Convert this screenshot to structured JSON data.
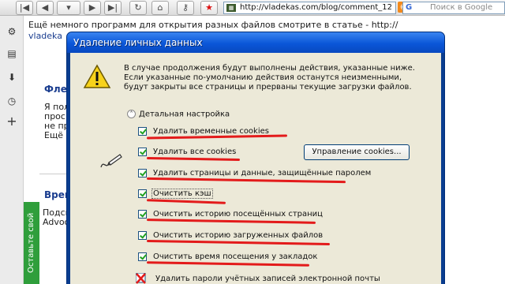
{
  "browser": {
    "address": "http://vladekas.com/blog/comment_12",
    "search_placeholder": "Поиск в Google",
    "search_engine": "G"
  },
  "page": {
    "line1": "Ещё немного программ для открытия разных файлов смотрите в статье - http://",
    "line2": "vladeka",
    "heading1": "Флеш",
    "para1": [
      "Я пол",
      "просма",
      "не про",
      "Ещё ра"
    ],
    "heading2": "Врем",
    "para2": [
      "Подска",
      "Advoce"
    ],
    "feedback_tab": "Оставьте свой отзыв"
  },
  "dialog": {
    "title": "Удаление личных данных",
    "description": "В случае продолжения будут выполнены действия, указанные ниже. Если указанные по-умолчанию действия останутся неизменными, будут закрыты все страницы и прерваны текущие загрузки файлов.",
    "section_label": "Детальная настройка",
    "manage_cookies_button": "Управление cookies...",
    "options": [
      {
        "label": "Удалить временные cookies",
        "checked": true
      },
      {
        "label": "Удалить все cookies",
        "checked": true
      },
      {
        "label": "Удалить страницы и данные, защищённые паролем",
        "checked": true
      },
      {
        "label": "Очистить кэш",
        "checked": true
      },
      {
        "label": "Очистить историю посещённых страниц",
        "checked": true
      },
      {
        "label": "Очистить историю загруженных файлов",
        "checked": true
      },
      {
        "label": "Очистить время посещения у закладок",
        "checked": true
      },
      {
        "label": "Удалить пароли учётных записей электронной почты",
        "checked": false
      }
    ]
  },
  "colors": {
    "title_bar": "#0a56d8",
    "dialog_bg": "#ece9d8",
    "annotation_red": "#e31b1b",
    "check_green": "#21a121",
    "feedback_green": "#2f9e3b"
  }
}
